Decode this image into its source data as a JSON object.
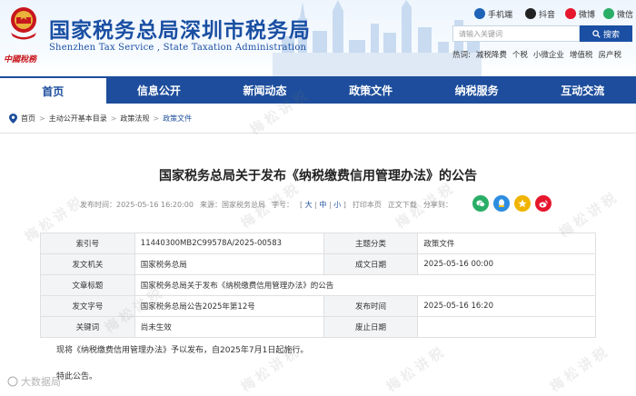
{
  "header": {
    "brand_script": "中國稅務",
    "title": "国家税务总局深圳市税务局",
    "title_en": "Shenzhen Tax Service , State Taxation Administration",
    "social": [
      {
        "label": "手机端",
        "icon": "phone-icon"
      },
      {
        "label": "抖音",
        "icon": "tiktok-icon"
      },
      {
        "label": "微博",
        "icon": "weibo-icon"
      },
      {
        "label": "微信",
        "icon": "wechat-icon"
      }
    ],
    "search": {
      "placeholder": "请输入关键词",
      "button": "搜索"
    },
    "hot_words_label": "热词:",
    "hot_words": [
      "减税降费",
      "个税",
      "小微企业",
      "增值税",
      "房产税"
    ]
  },
  "nav": [
    "首页",
    "信息公开",
    "新闻动态",
    "政策文件",
    "纳税服务",
    "互动交流"
  ],
  "breadcrumb": [
    "首页",
    "主动公开基本目录",
    "政策法规",
    "政策文件"
  ],
  "article": {
    "title": "国家税务总局关于发布《纳税缴费信用管理办法》的公告",
    "meta": {
      "published": "发布时间：2025-05-16 16:20:00",
      "source": "来源：国家税务总局",
      "font_size_label": "字号：",
      "font_sizes": [
        "大",
        "中",
        "小"
      ],
      "print": "打印本页",
      "download": "正文下载",
      "share": "分享到："
    },
    "info_rows": [
      {
        "k1": "索引号",
        "v1": "11440300MB2C99578A/2025-00583",
        "k2": "主题分类",
        "v2": "政策文件"
      },
      {
        "k1": "发文机关",
        "v1": "国家税务总局",
        "k2": "成文日期",
        "v2": "2025-05-16 00:00"
      },
      {
        "k1": "文章标题",
        "v1": "国家税务总局关于发布《纳税缴费信用管理办法》的公告"
      },
      {
        "k1": "发文字号",
        "v1": "国家税务总局公告2025年第12号",
        "k2": "发布时间",
        "v2": "2025-05-16 16:20"
      },
      {
        "k1": "关键词",
        "v1": "尚未生效",
        "k2": "废止日期",
        "v2": ""
      }
    ],
    "body": "现将《纳税缴费信用管理办法》予以发布，自2025年7月1日起施行。",
    "sign_off": "特此公告。"
  },
  "watermarks": [
    "梅松讲税"
  ],
  "corner_mark": "大数据局",
  "colors": {
    "primary": "#1d4d9c",
    "red": "#c8171d"
  }
}
